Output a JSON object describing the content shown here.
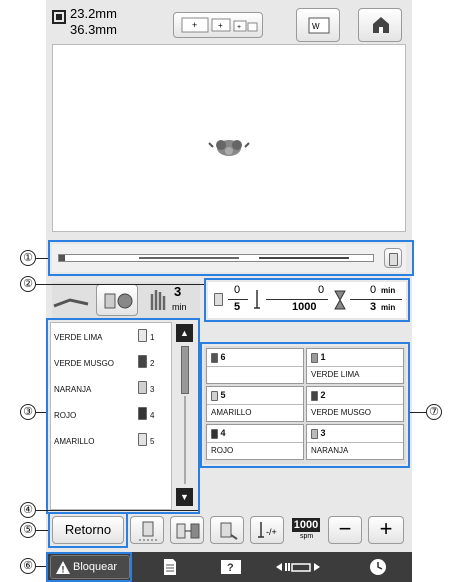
{
  "header": {
    "width_value": "23.2mm",
    "height_value": "36.3mm"
  },
  "progress": {
    "fraction": 0.02
  },
  "stats": {
    "time_label": "min",
    "stitch_current": "0",
    "stitch_total": "1000",
    "color_current": "0",
    "color_total": "5",
    "time_current": "0",
    "time_total": "3",
    "tab_time": "3",
    "tab_unit": "min"
  },
  "thread_list": [
    {
      "name": "VERDE LIMA",
      "num": "1",
      "color": "#e8e8e8"
    },
    {
      "name": "VERDE MUSGO",
      "num": "2",
      "color": "#444444"
    },
    {
      "name": "NARANJA",
      "num": "3",
      "color": "#cfcfcf"
    },
    {
      "name": "ROJO",
      "num": "4",
      "color": "#333333"
    },
    {
      "name": "AMARILLO",
      "num": "5",
      "color": "#e2e2e2"
    }
  ],
  "needle_grid": [
    {
      "num": "6",
      "name": "",
      "color": "#555555"
    },
    {
      "num": "1",
      "name": "VERDE LIMA",
      "color": "#9a9a9a"
    },
    {
      "num": "5",
      "name": "AMARILLO",
      "color": "#d0d0d0"
    },
    {
      "num": "2",
      "name": "VERDE MUSGO",
      "color": "#444444"
    },
    {
      "num": "4",
      "name": "ROJO",
      "color": "#333333"
    },
    {
      "num": "3",
      "name": "NARANJA",
      "color": "#bbbbbb"
    }
  ],
  "toolbar": {
    "return_label": "Retorno",
    "speed_value": "1000",
    "speed_unit": "spm"
  },
  "bottom_bar": {
    "lock_label": "Bloquear"
  },
  "callouts": [
    "①",
    "②",
    "③",
    "④",
    "⑤",
    "⑥",
    "⑦"
  ],
  "colors": {
    "accent_blue": "#2b7fe0",
    "lock_bar": "#404040"
  }
}
